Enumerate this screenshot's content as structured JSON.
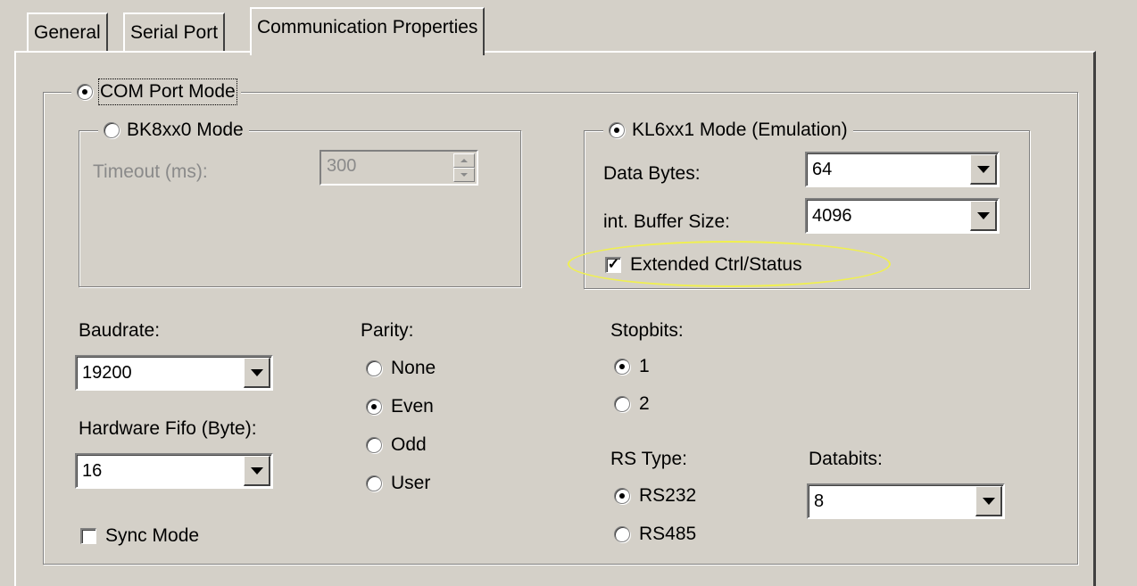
{
  "tabs": [
    {
      "label": "General"
    },
    {
      "label": "Serial Port"
    },
    {
      "label": "Communication Properties"
    }
  ],
  "com_port_mode": {
    "label": "COM Port Mode",
    "selected": true
  },
  "bk_mode": {
    "label": "BK8xx0 Mode",
    "selected": false,
    "timeout_label": "Timeout (ms):",
    "timeout_value": "300"
  },
  "kl_mode": {
    "label": "KL6xx1 Mode (Emulation)",
    "selected": true,
    "data_bytes_label": "Data Bytes:",
    "data_bytes_value": "64",
    "buffer_label": "int. Buffer Size:",
    "buffer_value": "4096",
    "extended_label": "Extended Ctrl/Status",
    "extended_checked": true
  },
  "baudrate": {
    "label": "Baudrate:",
    "value": "19200"
  },
  "fifo": {
    "label": "Hardware Fifo (Byte):",
    "value": "16"
  },
  "sync_mode": {
    "label": "Sync Mode",
    "checked": false
  },
  "parity": {
    "label": "Parity:",
    "options": [
      "None",
      "Even",
      "Odd",
      "User"
    ],
    "selected": "Even"
  },
  "stopbits": {
    "label": "Stopbits:",
    "options": [
      "1",
      "2"
    ],
    "selected": "1"
  },
  "rs_type": {
    "label": "RS Type:",
    "options": [
      "RS232",
      "RS485"
    ],
    "selected": "RS232"
  },
  "databits": {
    "label": "Databits:",
    "value": "8"
  },
  "colors": {
    "window_bg": "#d4d0c8",
    "highlight": "#f0f050"
  }
}
